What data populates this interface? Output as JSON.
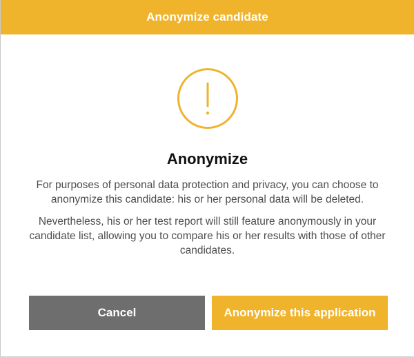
{
  "dialog": {
    "title": "Anonymize candidate",
    "heading": "Anonymize",
    "paragraphs": [
      "For purposes of personal data protection and privacy, you can choose to anonymize this candidate: his or her personal data will be deleted.",
      "Nevertheless, his or her test report will still feature anonymously in your candidate list, allowing you to compare his or her results with those of other candidates."
    ],
    "icon": "exclamation-circle-icon",
    "buttons": {
      "cancel_label": "Cancel",
      "confirm_label": "Anonymize this application"
    }
  },
  "colors": {
    "accent": "#f0b32c",
    "cancel": "#6e6e6e",
    "text": "#4d4d4d",
    "heading": "#111111"
  }
}
